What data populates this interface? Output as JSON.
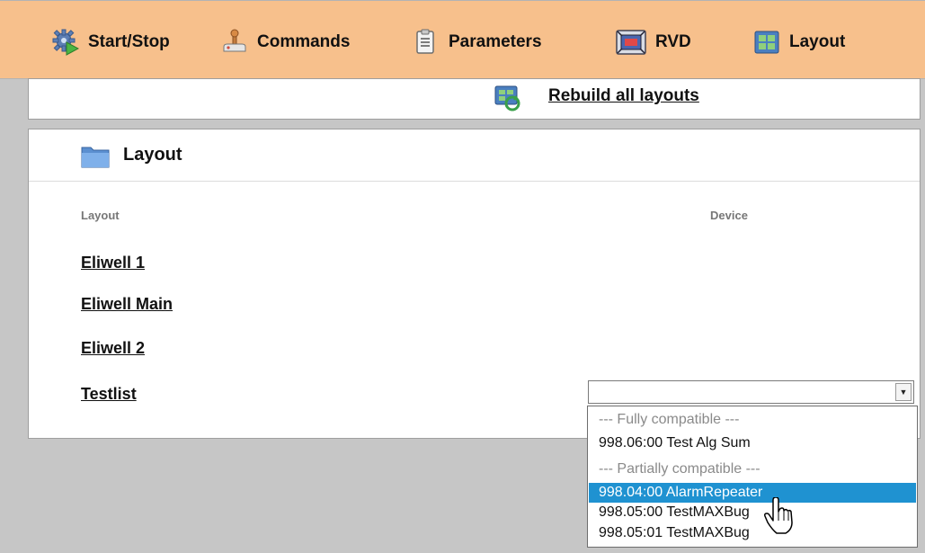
{
  "nav": {
    "items": [
      {
        "label": "Start/Stop",
        "icon": "start-stop-gear-icon"
      },
      {
        "label": "Commands",
        "icon": "joystick-icon"
      },
      {
        "label": "Parameters",
        "icon": "clipboard-icon"
      },
      {
        "label": "RVD",
        "icon": "rvd-screen-icon"
      },
      {
        "label": "Layout",
        "icon": "layout-grid-icon"
      }
    ]
  },
  "rebuild": {
    "label": "Rebuild all layouts",
    "icon": "rebuild-layouts-icon"
  },
  "layout_panel": {
    "title": "Layout",
    "columns": {
      "layout": "Layout",
      "device": "Device"
    },
    "rows": [
      {
        "name": "Eliwell 1"
      },
      {
        "name": "Eliwell Main"
      },
      {
        "name": "Eliwell 2"
      },
      {
        "name": "Testlist"
      }
    ],
    "device_select": {
      "value": ""
    }
  },
  "dropdown": {
    "options": [
      {
        "label": "--- Fully compatible ---",
        "group": true
      },
      {
        "label": "998.06:00 Test Alg Sum",
        "group": false
      },
      {
        "label": "--- Partially compatible ---",
        "group": true
      },
      {
        "label": "998.04:00 AlarmRepeater",
        "group": false,
        "selected": true
      },
      {
        "label": "998.05:00 TestMAXBug",
        "group": false
      },
      {
        "label": "998.05:01 TestMAXBug",
        "group": false
      }
    ]
  },
  "colors": {
    "topbar": "#f7c08c",
    "background": "#c6c6c6",
    "selected_option": "#1f92d1"
  }
}
